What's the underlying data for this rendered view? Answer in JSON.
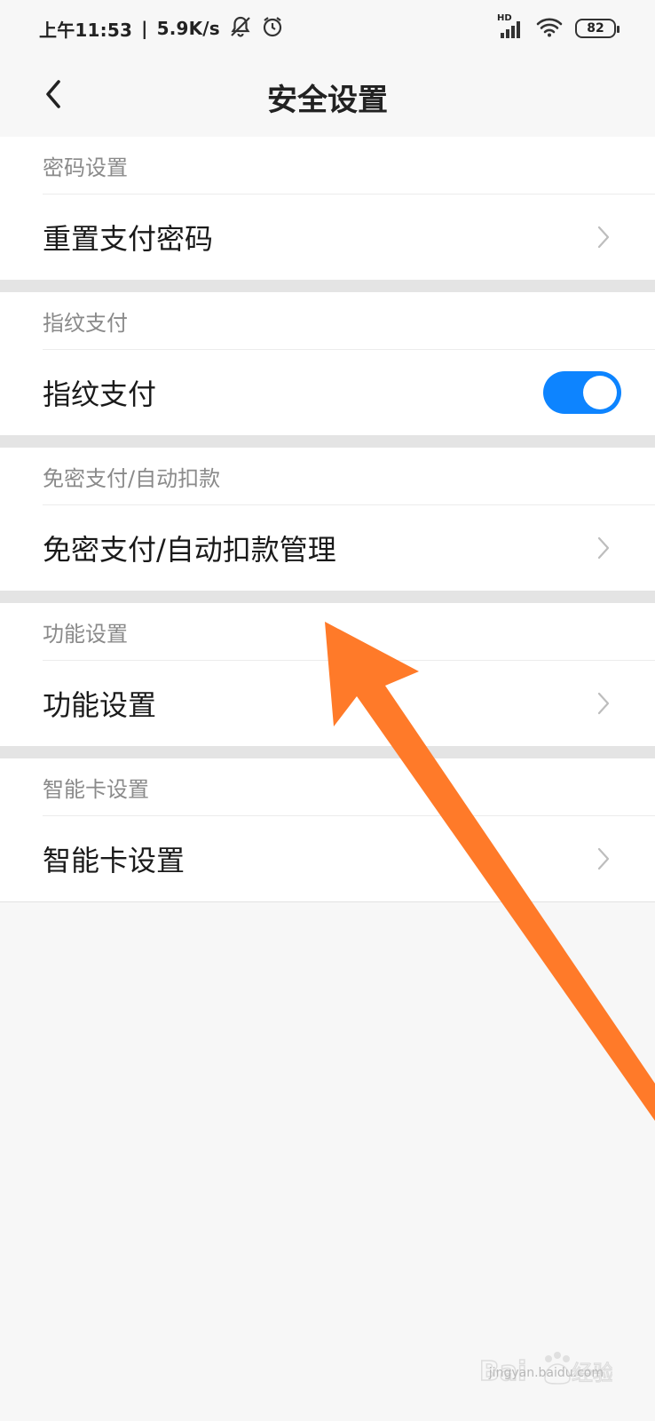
{
  "status_bar": {
    "time": "上午11:53",
    "separator": "|",
    "speed": "5.9K/s",
    "signal_label": "HD",
    "battery": "82",
    "icons": [
      "bell-off-icon",
      "alarm-icon",
      "signal-icon",
      "wifi-icon",
      "battery-icon"
    ]
  },
  "nav": {
    "title": "安全设置",
    "back_icon": "chevron-left-icon"
  },
  "sections": [
    {
      "header": "密码设置",
      "row_label": "重置支付密码",
      "control": "chevron"
    },
    {
      "header": "指纹支付",
      "row_label": "指纹支付",
      "control": "toggle",
      "toggle_on": true
    },
    {
      "header": "免密支付/自动扣款",
      "row_label": "免密支付/自动扣款管理",
      "control": "chevron"
    },
    {
      "header": "功能设置",
      "row_label": "功能设置",
      "control": "chevron"
    },
    {
      "header": "智能卡设置",
      "row_label": "智能卡设置",
      "control": "chevron"
    }
  ],
  "colors": {
    "toggle_on": "#0d84ff",
    "annotation_arrow": "#ff7a29",
    "section_header": "#8a8a8a",
    "background": "#f7f7f7"
  },
  "watermark": {
    "url_text": "jingyan.baidu.com"
  }
}
